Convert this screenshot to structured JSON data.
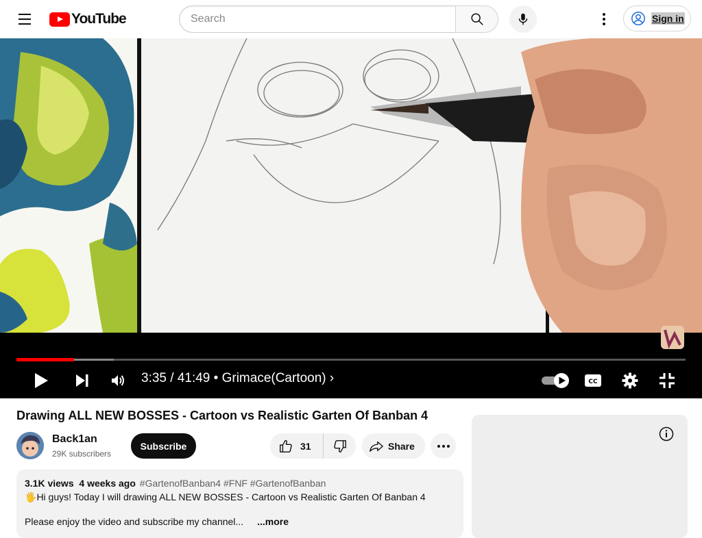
{
  "masthead": {
    "logo_text": "YouTube",
    "search_placeholder": "Search",
    "signin_label": "Sign in"
  },
  "player": {
    "time_current": "3:35",
    "time_total": "41:49",
    "chapter": "Grimace(Cartoon)",
    "progress_fraction": 0.086,
    "buffered_fraction": 0.145,
    "autoplay_on": true,
    "accent_color": "#ff0000"
  },
  "video": {
    "title": "Drawing ALL NEW BOSSES - Cartoon vs Realistic Garten Of Banban 4"
  },
  "channel": {
    "name": "Back1an",
    "subscribers": "29K subscribers",
    "subscribe_label": "Subscribe"
  },
  "actions": {
    "like_count": "31",
    "share_label": "Share"
  },
  "description": {
    "views": "3.1K views",
    "age": "4 weeks ago",
    "tags": "#GartenofBanban4 #FNF #GartenofBanban",
    "line1_emoji": "🖐",
    "line1": "Hi guys! Today I will drawing ALL NEW BOSSES - Cartoon vs Realistic Garten Of Banban 4",
    "line2": "Please enjoy the video and subscribe my channel...",
    "more_label": "...more"
  }
}
